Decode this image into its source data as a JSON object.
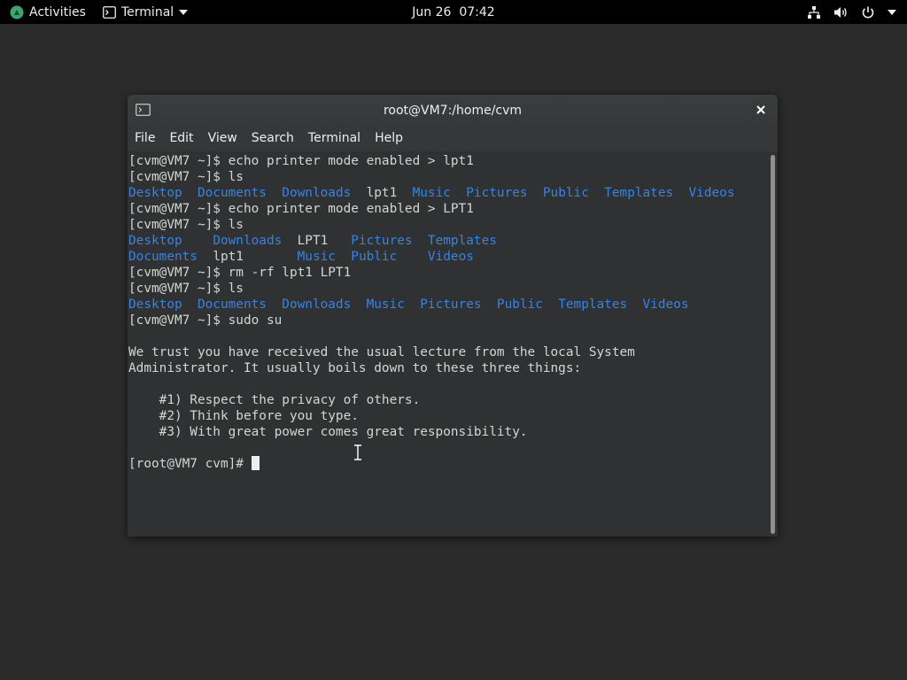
{
  "topbar": {
    "activities": "Activities",
    "app_menu": "Terminal",
    "clock": "Jun 26  07:42"
  },
  "window": {
    "title": "root@VM7:/home/cvm",
    "menu": [
      "File",
      "Edit",
      "View",
      "Search",
      "Terminal",
      "Help"
    ]
  },
  "terminal": {
    "lines": [
      {
        "prompt": "[cvm@VM7 ~]$ ",
        "cmd": "echo printer mode enabled > lpt1"
      },
      {
        "prompt": "[cvm@VM7 ~]$ ",
        "cmd": "ls"
      },
      {
        "ls": [
          {
            "t": "Desktop",
            "d": true
          },
          {
            "t": "  "
          },
          {
            "t": "Documents",
            "d": true
          },
          {
            "t": "  "
          },
          {
            "t": "Downloads",
            "d": true
          },
          {
            "t": "  "
          },
          {
            "t": "lpt1",
            "d": false
          },
          {
            "t": "  "
          },
          {
            "t": "Music",
            "d": true
          },
          {
            "t": "  "
          },
          {
            "t": "Pictures",
            "d": true
          },
          {
            "t": "  "
          },
          {
            "t": "Public",
            "d": true
          },
          {
            "t": "  "
          },
          {
            "t": "Templates",
            "d": true
          },
          {
            "t": "  "
          },
          {
            "t": "Videos",
            "d": true
          }
        ]
      },
      {
        "prompt": "[cvm@VM7 ~]$ ",
        "cmd": "echo printer mode enabled > LPT1"
      },
      {
        "prompt": "[cvm@VM7 ~]$ ",
        "cmd": "ls"
      },
      {
        "ls": [
          {
            "t": "Desktop",
            "d": true
          },
          {
            "t": "    "
          },
          {
            "t": "Downloads",
            "d": true
          },
          {
            "t": "  "
          },
          {
            "t": "LPT1",
            "d": false
          },
          {
            "t": "   "
          },
          {
            "t": "Pictures",
            "d": true
          },
          {
            "t": "  "
          },
          {
            "t": "Templates",
            "d": true
          }
        ]
      },
      {
        "ls": [
          {
            "t": "Documents",
            "d": true
          },
          {
            "t": "  "
          },
          {
            "t": "lpt1",
            "d": false
          },
          {
            "t": "       "
          },
          {
            "t": "Music",
            "d": true
          },
          {
            "t": "  "
          },
          {
            "t": "Public",
            "d": true
          },
          {
            "t": "    "
          },
          {
            "t": "Videos",
            "d": true
          }
        ]
      },
      {
        "prompt": "[cvm@VM7 ~]$ ",
        "cmd": "rm -rf lpt1 LPT1"
      },
      {
        "prompt": "[cvm@VM7 ~]$ ",
        "cmd": "ls"
      },
      {
        "ls": [
          {
            "t": "Desktop",
            "d": true
          },
          {
            "t": "  "
          },
          {
            "t": "Documents",
            "d": true
          },
          {
            "t": "  "
          },
          {
            "t": "Downloads",
            "d": true
          },
          {
            "t": "  "
          },
          {
            "t": "Music",
            "d": true
          },
          {
            "t": "  "
          },
          {
            "t": "Pictures",
            "d": true
          },
          {
            "t": "  "
          },
          {
            "t": "Public",
            "d": true
          },
          {
            "t": "  "
          },
          {
            "t": "Templates",
            "d": true
          },
          {
            "t": "  "
          },
          {
            "t": "Videos",
            "d": true
          }
        ]
      },
      {
        "prompt": "[cvm@VM7 ~]$ ",
        "cmd": "sudo su"
      },
      {
        "text": ""
      },
      {
        "text": "We trust you have received the usual lecture from the local System"
      },
      {
        "text": "Administrator. It usually boils down to these three things:"
      },
      {
        "text": ""
      },
      {
        "text": "    #1) Respect the privacy of others."
      },
      {
        "text": "    #2) Think before you type."
      },
      {
        "text": "    #3) With great power comes great responsibility."
      },
      {
        "text": ""
      },
      {
        "prompt": "[root@VM7 cvm]# ",
        "cmd": "",
        "cursor": true
      }
    ]
  },
  "colors": {
    "directory": "#3584e4",
    "terminal_bg": "#2f3132",
    "topbar_bg": "#000000"
  },
  "icons": {
    "activities": "fedora-logo-icon",
    "terminal_app": "terminal-icon",
    "network": "network-icon",
    "volume": "volume-icon",
    "power": "power-icon"
  }
}
